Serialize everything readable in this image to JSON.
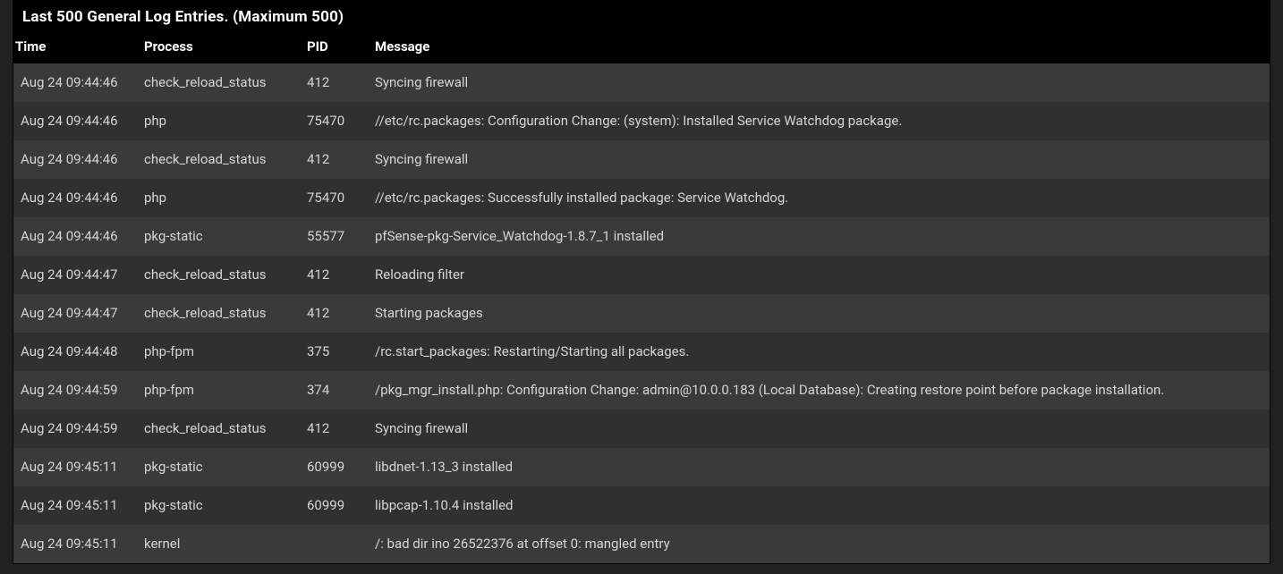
{
  "panel": {
    "title": "Last 500 General Log Entries. (Maximum 500)"
  },
  "table": {
    "headers": {
      "time": "Time",
      "process": "Process",
      "pid": "PID",
      "message": "Message"
    },
    "rows": [
      {
        "time": "Aug 24 09:44:46",
        "process": "check_reload_status",
        "pid": "412",
        "message": "Syncing firewall"
      },
      {
        "time": "Aug 24 09:44:46",
        "process": "php",
        "pid": "75470",
        "message": "//etc/rc.packages: Configuration Change: (system): Installed Service Watchdog package."
      },
      {
        "time": "Aug 24 09:44:46",
        "process": "check_reload_status",
        "pid": "412",
        "message": "Syncing firewall"
      },
      {
        "time": "Aug 24 09:44:46",
        "process": "php",
        "pid": "75470",
        "message": "//etc/rc.packages: Successfully installed package: Service Watchdog."
      },
      {
        "time": "Aug 24 09:44:46",
        "process": "pkg-static",
        "pid": "55577",
        "message": "pfSense-pkg-Service_Watchdog-1.8.7_1 installed"
      },
      {
        "time": "Aug 24 09:44:47",
        "process": "check_reload_status",
        "pid": "412",
        "message": "Reloading filter"
      },
      {
        "time": "Aug 24 09:44:47",
        "process": "check_reload_status",
        "pid": "412",
        "message": "Starting packages"
      },
      {
        "time": "Aug 24 09:44:48",
        "process": "php-fpm",
        "pid": "375",
        "message": "/rc.start_packages: Restarting/Starting all packages."
      },
      {
        "time": "Aug 24 09:44:59",
        "process": "php-fpm",
        "pid": "374",
        "message": "/pkg_mgr_install.php: Configuration Change: admin@10.0.0.183 (Local Database): Creating restore point before package installation."
      },
      {
        "time": "Aug 24 09:44:59",
        "process": "check_reload_status",
        "pid": "412",
        "message": "Syncing firewall"
      },
      {
        "time": "Aug 24 09:45:11",
        "process": "pkg-static",
        "pid": "60999",
        "message": "libdnet-1.13_3 installed"
      },
      {
        "time": "Aug 24 09:45:11",
        "process": "pkg-static",
        "pid": "60999",
        "message": "libpcap-1.10.4 installed"
      },
      {
        "time": "Aug 24 09:45:11",
        "process": "kernel",
        "pid": "",
        "message": "/: bad dir ino 26522376 at offset 0: mangled entry"
      }
    ]
  }
}
